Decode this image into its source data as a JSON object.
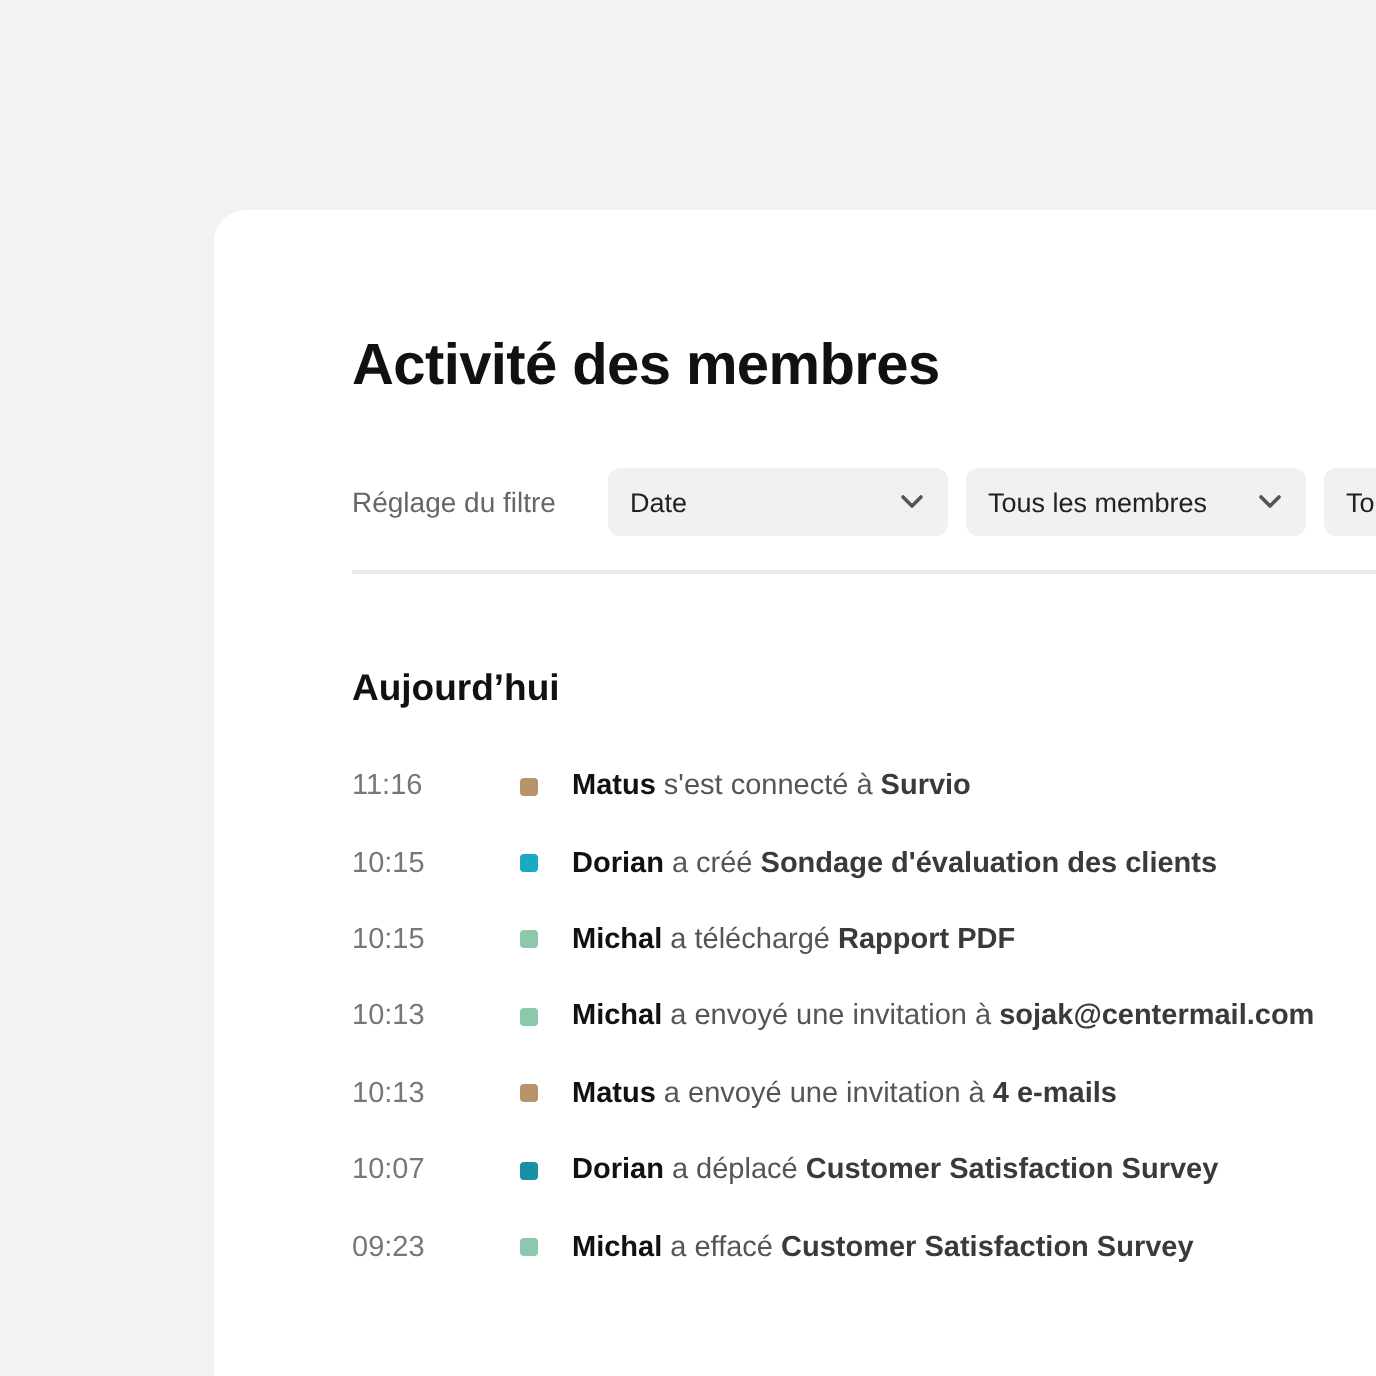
{
  "title": "Activité des membres",
  "filter": {
    "label": "Réglage du filtre",
    "selects": [
      {
        "value": "Date",
        "kind": "dropdown"
      },
      {
        "value": "Tous les membres",
        "kind": "dropdown"
      },
      {
        "value": "To",
        "kind": "dropdown"
      }
    ]
  },
  "section": "Aujourd’hui",
  "activities": [
    {
      "time": "11:16",
      "color": "#b8926a",
      "text": "**Matus** s'est connecté à **Survio**"
    },
    {
      "time": "10:15",
      "color": "#19a8c6",
      "text": "**Dorian** a créé  **Sondage d'évaluation des clients**"
    },
    {
      "time": "10:15",
      "color": "#8cc8ac",
      "text": "**Michal** a téléchargé **Rapport PDF**"
    },
    {
      "time": "10:13",
      "color": "#8cc8ac",
      "text": "**Michal** a envoyé une invitation à **sojak@centermail.com**"
    },
    {
      "time": "10:13",
      "color": "#b8926a",
      "text": "**Matus** a envoyé une invitation à **4 e-mails**"
    },
    {
      "time": "10:07",
      "color": "#1b8fa6",
      "text": "**Dorian** a déplacé **Customer Satisfaction Survey**"
    },
    {
      "time": "09:23",
      "color": "#8cc8ac",
      "text": "**Michal** a effacé **Customer Satisfaction Survey**"
    }
  ]
}
